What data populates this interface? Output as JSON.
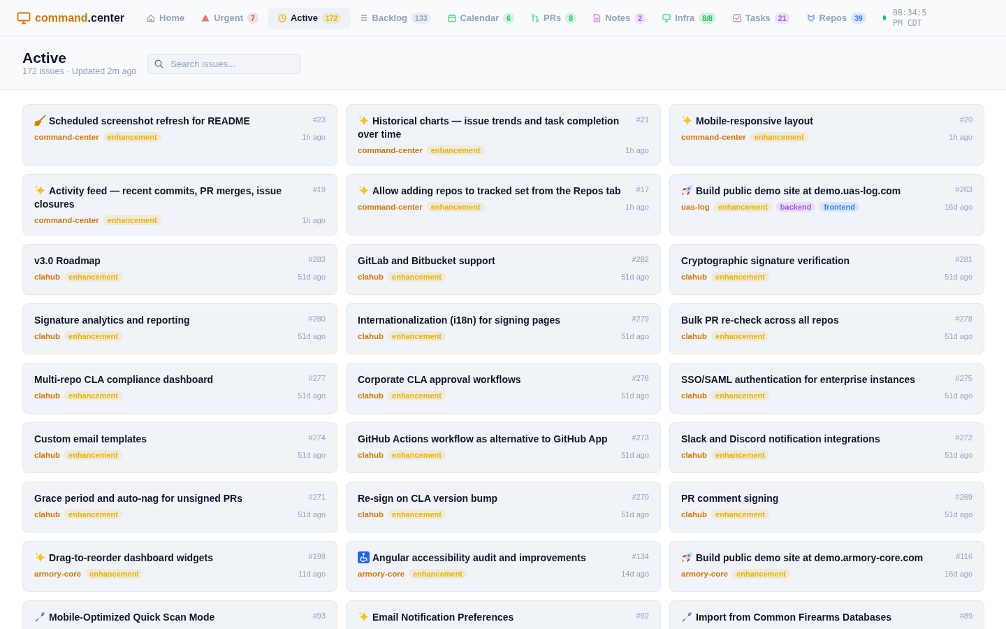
{
  "logo": {
    "main": "command",
    "suffix": ".center"
  },
  "nav": [
    {
      "kind": "home",
      "label": "Home",
      "selected": false
    },
    {
      "kind": "alert",
      "label": "Urgent",
      "count": "7",
      "color": "#ef4444",
      "selected": false
    },
    {
      "kind": "clock",
      "label": "Active",
      "count": "172",
      "color": "#eab308",
      "selected": true
    },
    {
      "kind": "list",
      "label": "Backlog",
      "count": "133",
      "color": "#94a3b8",
      "selected": false
    },
    {
      "kind": "calendar",
      "label": "Calendar",
      "count": "6",
      "color": "#22c55e",
      "selected": false
    },
    {
      "kind": "branch",
      "label": "PRs",
      "count": "8",
      "color": "#22c55e",
      "selected": false
    },
    {
      "kind": "note",
      "label": "Notes",
      "count": "2",
      "color": "#a855f7",
      "selected": false
    },
    {
      "kind": "monitor",
      "label": "Infra",
      "count": "8/8",
      "color": "#22c55e",
      "selected": false
    },
    {
      "kind": "task",
      "label": "Tasks",
      "count": "21",
      "color": "#a855f7",
      "selected": false
    },
    {
      "kind": "repo",
      "label": "Repos",
      "count": "39",
      "color": "#3b82f6",
      "selected": false
    }
  ],
  "clock": {
    "time": "08:34:5",
    "zone": "PM CDT"
  },
  "page": {
    "title": "Active",
    "subtitle": "172 issues · Updated 2m ago"
  },
  "search": {
    "placeholder": "Search issues..."
  },
  "issues": [
    {
      "kind": "broom",
      "title": "Scheduled screenshot refresh for README",
      "number": "#23",
      "repo": "command-center",
      "tags": [
        {
          "label": "enhancement",
          "color": "#eab308"
        }
      ],
      "age": "1h ago"
    },
    {
      "kind": "sparkles",
      "title": "Historical charts — issue trends and task completion over time",
      "number": "#21",
      "repo": "command-center",
      "tags": [
        {
          "label": "enhancement",
          "color": "#eab308"
        }
      ],
      "age": "1h ago"
    },
    {
      "kind": "sparkles",
      "title": "Mobile-responsive layout",
      "number": "#20",
      "repo": "command-center",
      "tags": [
        {
          "label": "enhancement",
          "color": "#eab308"
        }
      ],
      "age": "1h ago"
    },
    {
      "kind": "sparkles",
      "title": "Activity feed — recent commits, PR merges, issue closures",
      "number": "#19",
      "repo": "command-center",
      "tags": [
        {
          "label": "enhancement",
          "color": "#eab308"
        }
      ],
      "age": "1h ago"
    },
    {
      "kind": "sparkles",
      "title": "Allow adding repos to tracked set from the Repos tab",
      "number": "#17",
      "repo": "command-center",
      "tags": [
        {
          "label": "enhancement",
          "color": "#eab308"
        }
      ],
      "age": "1h ago"
    },
    {
      "kind": "rocket",
      "title": "Build public demo site at demo.uas-log.com",
      "number": "#263",
      "repo": "uas-log",
      "tags": [
        {
          "label": "enhancement",
          "color": "#eab308"
        },
        {
          "label": "backend",
          "color": "#a855f7"
        },
        {
          "label": "frontend",
          "color": "#3b82f6"
        }
      ],
      "age": "16d ago"
    },
    {
      "kind": "none",
      "title": "v3.0 Roadmap",
      "number": "#283",
      "repo": "clahub",
      "tags": [
        {
          "label": "enhancement",
          "color": "#eab308"
        }
      ],
      "age": "51d ago"
    },
    {
      "kind": "none",
      "title": "GitLab and Bitbucket support",
      "number": "#282",
      "repo": "clahub",
      "tags": [
        {
          "label": "enhancement",
          "color": "#eab308"
        }
      ],
      "age": "51d ago"
    },
    {
      "kind": "none",
      "title": "Cryptographic signature verification",
      "number": "#281",
      "repo": "clahub",
      "tags": [
        {
          "label": "enhancement",
          "color": "#eab308"
        }
      ],
      "age": "51d ago"
    },
    {
      "kind": "none",
      "title": "Signature analytics and reporting",
      "number": "#280",
      "repo": "clahub",
      "tags": [
        {
          "label": "enhancement",
          "color": "#eab308"
        }
      ],
      "age": "51d ago"
    },
    {
      "kind": "none",
      "title": "Internationalization (i18n) for signing pages",
      "number": "#279",
      "repo": "clahub",
      "tags": [
        {
          "label": "enhancement",
          "color": "#eab308"
        }
      ],
      "age": "51d ago"
    },
    {
      "kind": "none",
      "title": "Bulk PR re-check across all repos",
      "number": "#278",
      "repo": "clahub",
      "tags": [
        {
          "label": "enhancement",
          "color": "#eab308"
        }
      ],
      "age": "51d ago"
    },
    {
      "kind": "none",
      "title": "Multi-repo CLA compliance dashboard",
      "number": "#277",
      "repo": "clahub",
      "tags": [
        {
          "label": "enhancement",
          "color": "#eab308"
        }
      ],
      "age": "51d ago"
    },
    {
      "kind": "none",
      "title": "Corporate CLA approval workflows",
      "number": "#276",
      "repo": "clahub",
      "tags": [
        {
          "label": "enhancement",
          "color": "#eab308"
        }
      ],
      "age": "51d ago"
    },
    {
      "kind": "none",
      "title": "SSO/SAML authentication for enterprise instances",
      "number": "#275",
      "repo": "clahub",
      "tags": [
        {
          "label": "enhancement",
          "color": "#eab308"
        }
      ],
      "age": "51d ago"
    },
    {
      "kind": "none",
      "title": "Custom email templates",
      "number": "#274",
      "repo": "clahub",
      "tags": [
        {
          "label": "enhancement",
          "color": "#eab308"
        }
      ],
      "age": "51d ago"
    },
    {
      "kind": "none",
      "title": "GitHub Actions workflow as alternative to GitHub App",
      "number": "#273",
      "repo": "clahub",
      "tags": [
        {
          "label": "enhancement",
          "color": "#eab308"
        }
      ],
      "age": "51d ago"
    },
    {
      "kind": "none",
      "title": "Slack and Discord notification integrations",
      "number": "#272",
      "repo": "clahub",
      "tags": [
        {
          "label": "enhancement",
          "color": "#eab308"
        }
      ],
      "age": "51d ago"
    },
    {
      "kind": "none",
      "title": "Grace period and auto-nag for unsigned PRs",
      "number": "#271",
      "repo": "clahub",
      "tags": [
        {
          "label": "enhancement",
          "color": "#eab308"
        }
      ],
      "age": "51d ago"
    },
    {
      "kind": "none",
      "title": "Re-sign on CLA version bump",
      "number": "#270",
      "repo": "clahub",
      "tags": [
        {
          "label": "enhancement",
          "color": "#eab308"
        }
      ],
      "age": "51d ago"
    },
    {
      "kind": "none",
      "title": "PR comment signing",
      "number": "#269",
      "repo": "clahub",
      "tags": [
        {
          "label": "enhancement",
          "color": "#eab308"
        }
      ],
      "age": "51d ago"
    },
    {
      "kind": "sparkles",
      "title": "Drag-to-reorder dashboard widgets",
      "number": "#199",
      "repo": "armory-core",
      "tags": [
        {
          "label": "enhancement",
          "color": "#eab308"
        }
      ],
      "age": "11d ago"
    },
    {
      "kind": "wheelchair",
      "title": "Angular accessibility audit and improvements",
      "number": "#134",
      "repo": "armory-core",
      "tags": [
        {
          "label": "enhancement",
          "color": "#eab308"
        }
      ],
      "age": "14d ago"
    },
    {
      "kind": "rocket",
      "title": "Build public demo site at demo.armory-core.com",
      "number": "#116",
      "repo": "armory-core",
      "tags": [
        {
          "label": "enhancement",
          "color": "#eab308"
        }
      ],
      "age": "16d ago"
    },
    {
      "kind": "wrench",
      "title": "Mobile-Optimized Quick Scan Mode",
      "number": "#93"
    },
    {
      "kind": "sparkles",
      "title": "Email Notification Preferences",
      "number": "#92"
    },
    {
      "kind": "wrench",
      "title": "Import from Common Firearms Databases",
      "number": "#89"
    }
  ]
}
